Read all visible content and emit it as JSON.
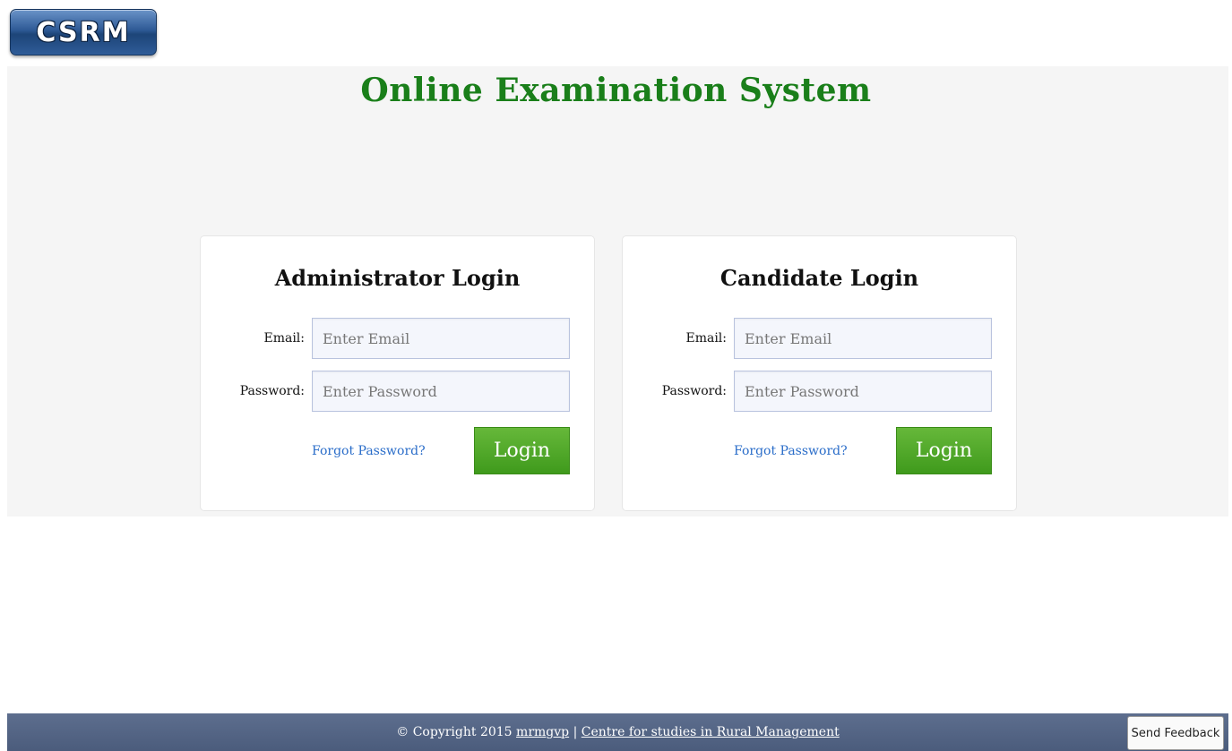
{
  "logo": {
    "text": "CSRM"
  },
  "page": {
    "title": "Online Examination System"
  },
  "admin_login": {
    "title": "Administrator Login",
    "email_label": "Email:",
    "email_placeholder": "Enter Email",
    "password_label": "Password:",
    "password_placeholder": "Enter Password",
    "forgot_label": "Forgot Password?",
    "login_label": "Login"
  },
  "candidate_login": {
    "title": "Candidate Login",
    "email_label": "Email:",
    "email_placeholder": "Enter Email",
    "password_label": "Password:",
    "password_placeholder": "Enter Password",
    "forgot_label": "Forgot Password?",
    "login_label": "Login"
  },
  "footer": {
    "copyright": "© Copyright 2015",
    "link1": "mrmgvp",
    "separator": "|",
    "link2": "Centre for studies in Rural Management",
    "feedback_label": "Send Feedback"
  },
  "colors": {
    "title_green": "#1a7f1a",
    "login_green": "#4fa527",
    "link_blue": "#2a6dc9",
    "footer_bg": "#536485"
  }
}
